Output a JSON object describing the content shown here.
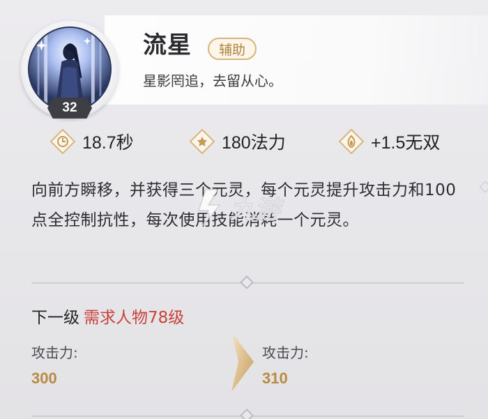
{
  "skill": {
    "name": "流星",
    "type_tag": "辅助",
    "subtitle": "星影罔追，去留从心。",
    "level": "32",
    "portrait_icon": "character-portrait"
  },
  "stats": [
    {
      "icon": "clock-icon",
      "value": "18.7秒"
    },
    {
      "icon": "star-icon",
      "value": "180法力"
    },
    {
      "icon": "flame-icon",
      "value": "+1.5无双"
    }
  ],
  "description": "向前方瞬移，并获得三个元灵，每个元灵提升攻击力和100点全控制抗性，每次使用技能消耗一个元灵。",
  "next_level": {
    "label": "下一级",
    "requirement": "需求人物78级"
  },
  "attribute": {
    "current_label": "攻击力:",
    "current_value": "300",
    "next_label": "攻击力:",
    "next_value": "310"
  },
  "watermark": {
    "logo": "九游",
    "icon": "jiuyou-logo-icon"
  },
  "colors": {
    "accent_gold": "#b88a43",
    "requirement_red": "#c8423b",
    "badge_dark": "#3d3f44"
  }
}
